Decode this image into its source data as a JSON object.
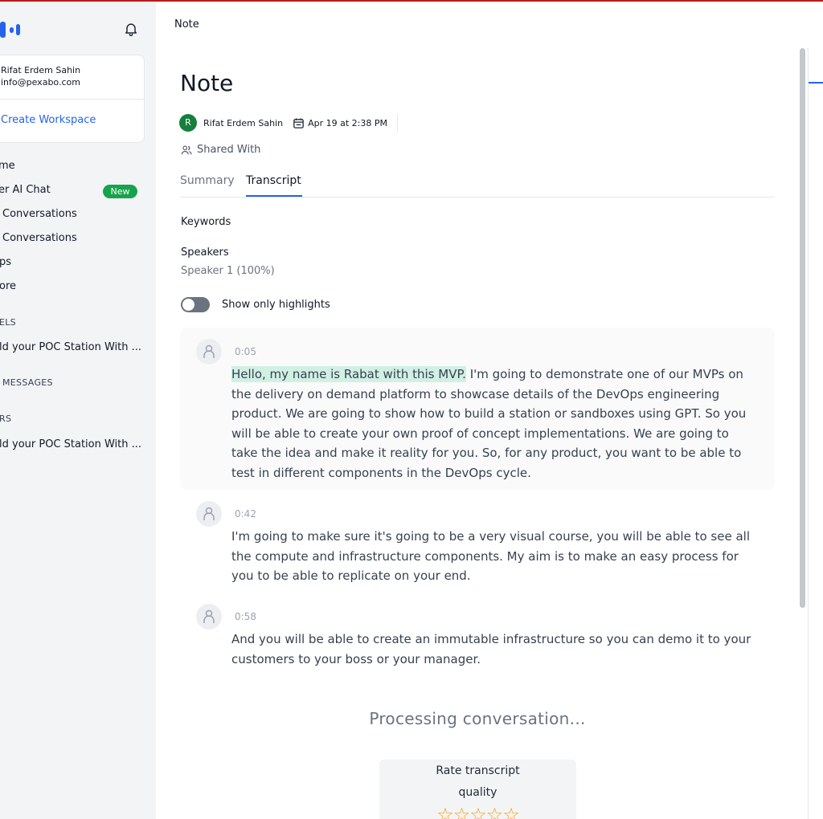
{
  "sidebar": {
    "profile": {
      "name": "Rifat Erdem Sahin",
      "email": "info@pexabo.com",
      "create_workspace": "Create Workspace"
    },
    "nav": [
      "me",
      "er AI Chat",
      "Conversations",
      "Conversations",
      "ps",
      "ore"
    ],
    "new_badge": "New",
    "sections": {
      "channels": "ELS",
      "messages": "MESSAGES",
      "members": "RS"
    },
    "channel_item": "ld your POC Station With ...",
    "member_item": "ld your POC Station With ..."
  },
  "header": {
    "breadcrumb": "Note"
  },
  "note": {
    "title": "Note",
    "author_initial": "R",
    "author": "Rifat Erdem Sahin",
    "date": "Apr 19 at 2:38 PM",
    "shared_with": "Shared With",
    "tabs": [
      "Summary",
      "Transcript"
    ],
    "active_tab": "Transcript",
    "keywords_label": "Keywords",
    "speakers_label": "Speakers",
    "speaker_value": "Speaker 1 (100%)",
    "highlights_toggle": {
      "label": "Show only highlights",
      "on": false
    }
  },
  "transcript": [
    {
      "time": "0:05",
      "highlight": "Hello, my name is Rabat with this MVP.",
      "text": " I'm going to demonstrate one of our MVPs on the delivery on demand platform to showcase details of the DevOps engineering product. We are going to show how to build a station or sandboxes using GPT. So you will be able to create your own proof of concept implementations. We are going to take the idea and make it reality for you. So, for any product, you want to be able to test in different components in the DevOps cycle."
    },
    {
      "time": "0:42",
      "highlight": "",
      "text": "I'm going to make sure it's going to be a very visual course, you will be able to see all the compute and infrastructure components. My aim is to make an easy process for you to be able to replicate on your end."
    },
    {
      "time": "0:58",
      "highlight": "",
      "text": "And you will be able to create an immutable infrastructure so you can demo it to your customers to your boss or your manager."
    }
  ],
  "processing": "Processing conversation...",
  "rating": {
    "line1": "Rate transcript",
    "line2": "quality",
    "stars": 5,
    "star_color": "#f59e0b"
  },
  "colors": {
    "accent": "#2563eb",
    "highlight": "#d1f0e3",
    "avatar": "#15803d",
    "new_badge": "#16a34a"
  }
}
